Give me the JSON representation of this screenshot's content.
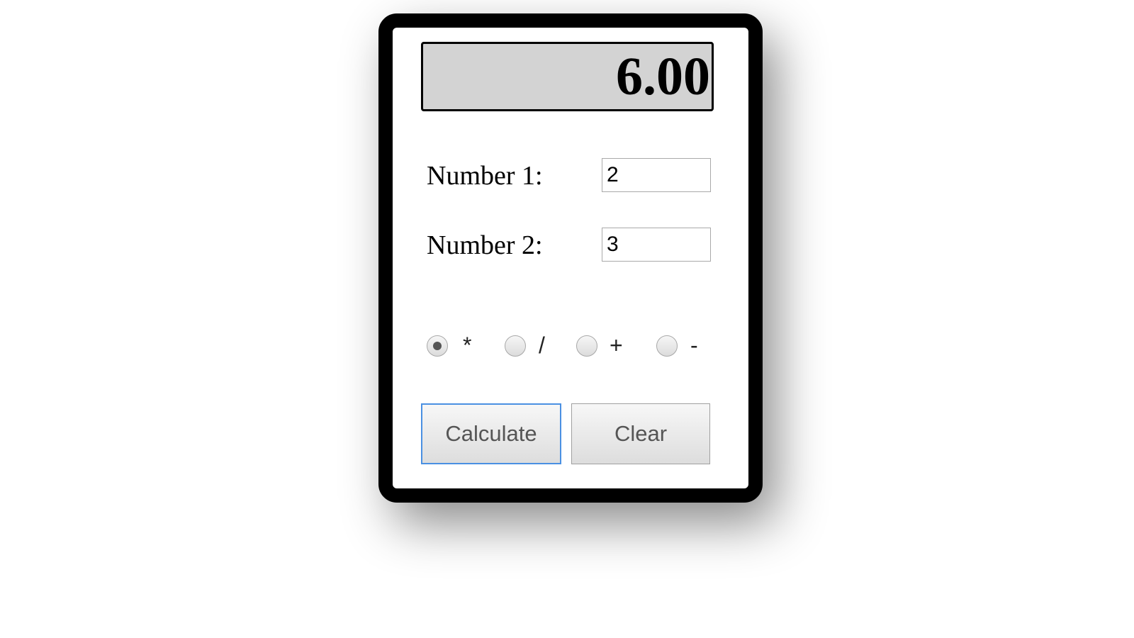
{
  "display": {
    "value": "6.00"
  },
  "inputs": [
    {
      "label": "Number 1:",
      "value": "2"
    },
    {
      "label": "Number 2:",
      "value": "3"
    }
  ],
  "operations": [
    {
      "symbol": "*",
      "checked": true
    },
    {
      "symbol": "/",
      "checked": false
    },
    {
      "symbol": "+",
      "checked": false
    },
    {
      "symbol": "-",
      "checked": false
    }
  ],
  "buttons": {
    "calculate_label": "Calculate",
    "clear_label": "Clear"
  },
  "colors": {
    "display_bg": "#d3d3d3",
    "frame": "#000000",
    "focus_ring": "#4a90e2"
  }
}
